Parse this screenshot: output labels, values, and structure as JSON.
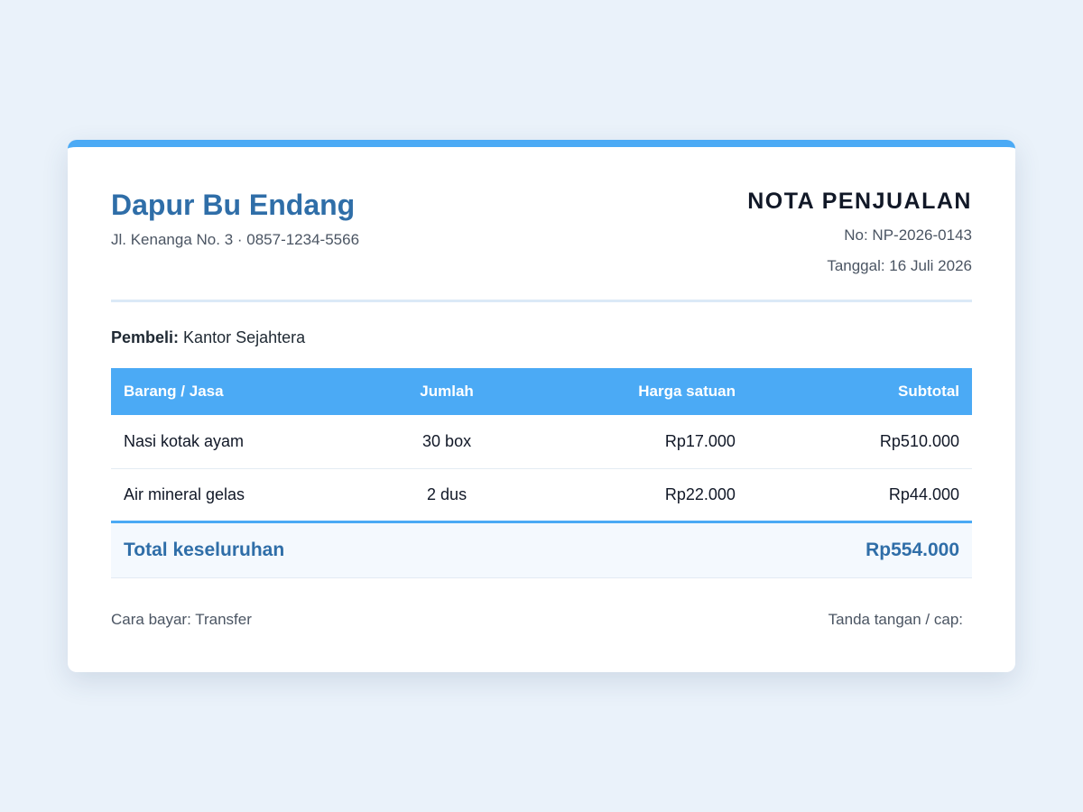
{
  "shop": {
    "name": "Dapur Bu Endang",
    "info": "Jl. Kenanga No. 3 · 0857-1234-5566"
  },
  "document": {
    "title": "NOTA PENJUALAN",
    "number": "No: NP-2026-0143",
    "date": "Tanggal: 16 Juli 2026"
  },
  "buyer": {
    "label": "Pembeli:",
    "name": "Kantor Sejahtera"
  },
  "table": {
    "headers": [
      "Barang / Jasa",
      "Jumlah",
      "Harga satuan",
      "Subtotal"
    ],
    "rows": [
      [
        "Nasi kotak ayam",
        "30 box",
        "Rp17.000",
        "Rp510.000"
      ],
      [
        "Air mineral gelas",
        "2 dus",
        "Rp22.000",
        "Rp44.000"
      ]
    ],
    "total_label": "Total keseluruhan",
    "total_value": "Rp554.000"
  },
  "footer": {
    "payment": "Cara bayar: Transfer",
    "signature": "Tanda tangan / cap:"
  },
  "colors": {
    "accent": "#4baaf5",
    "brand": "#2f6ea8",
    "background": "#eaf2fa"
  }
}
